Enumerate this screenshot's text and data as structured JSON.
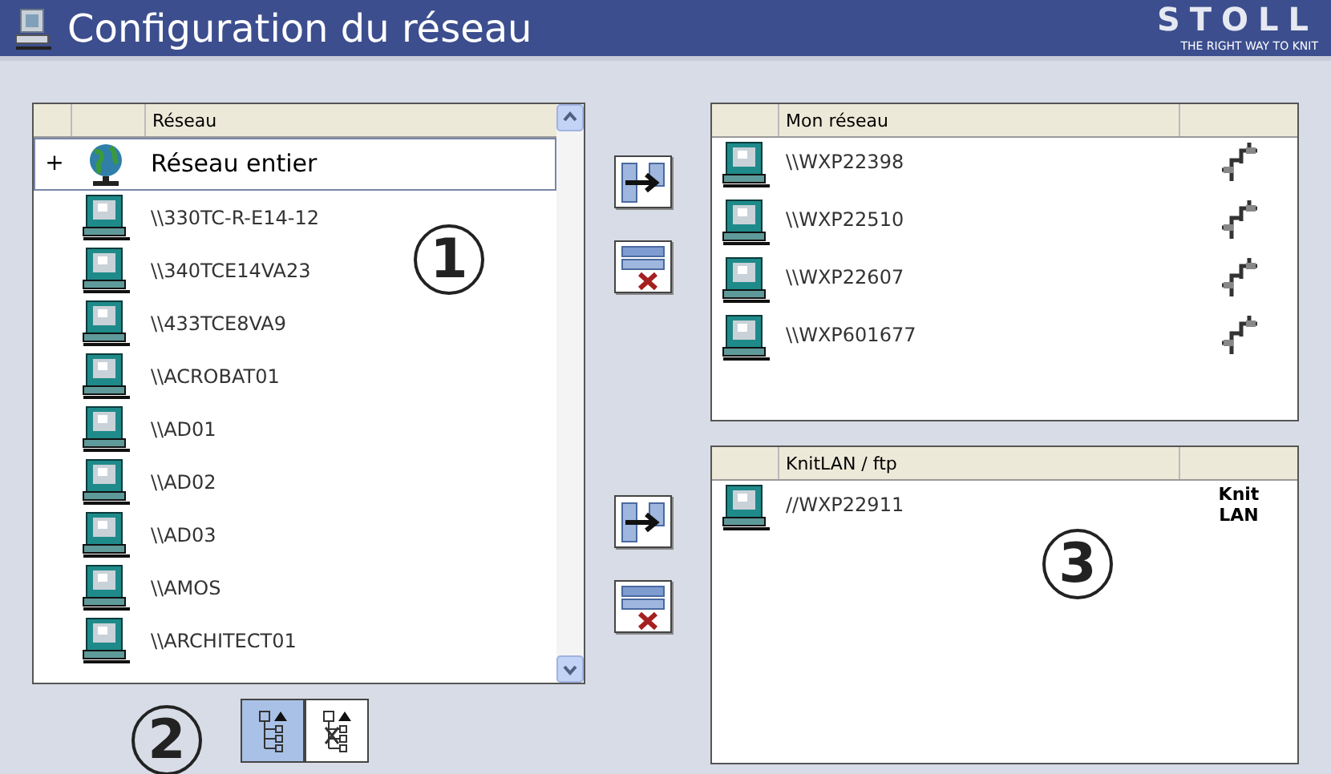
{
  "header": {
    "title": "Configuration du réseau",
    "brand": "STOLL",
    "tagline": "THE RIGHT WAY TO KNIT"
  },
  "network_list": {
    "column": "Réseau",
    "items": [
      {
        "kind": "group",
        "expander": "+",
        "label": "Réseau entier",
        "selected": true
      },
      {
        "kind": "computer",
        "label": "\\\\330TC-R-E14-12",
        "selected": false
      },
      {
        "kind": "computer",
        "label": "\\\\340TCE14VA23",
        "selected": false
      },
      {
        "kind": "computer",
        "label": "\\\\433TCE8VA9",
        "selected": false
      },
      {
        "kind": "computer",
        "label": "\\\\ACROBAT01",
        "selected": false
      },
      {
        "kind": "computer",
        "label": "\\\\AD01",
        "selected": false
      },
      {
        "kind": "computer",
        "label": "\\\\AD02",
        "selected": false
      },
      {
        "kind": "computer",
        "label": "\\\\AD03",
        "selected": false
      },
      {
        "kind": "computer",
        "label": "\\\\AMOS",
        "selected": false
      },
      {
        "kind": "computer",
        "label": "\\\\ARCHITECT01",
        "selected": false
      }
    ]
  },
  "view_buttons": [
    {
      "kind": "tree",
      "selected": true
    },
    {
      "kind": "tree-filter",
      "selected": false
    }
  ],
  "my_network": {
    "column": "Mon réseau",
    "rows": [
      {
        "name": "\\\\WXP22398"
      },
      {
        "name": "\\\\WXP22510"
      },
      {
        "name": "\\\\WXP22607"
      },
      {
        "name": "\\\\WXP601677"
      }
    ]
  },
  "knitlan": {
    "column": "KnitLAN / ftp",
    "rows": [
      {
        "name": "//WXP22911",
        "type": "Knit LAN"
      }
    ]
  },
  "callouts": [
    "1",
    "2",
    "3"
  ]
}
